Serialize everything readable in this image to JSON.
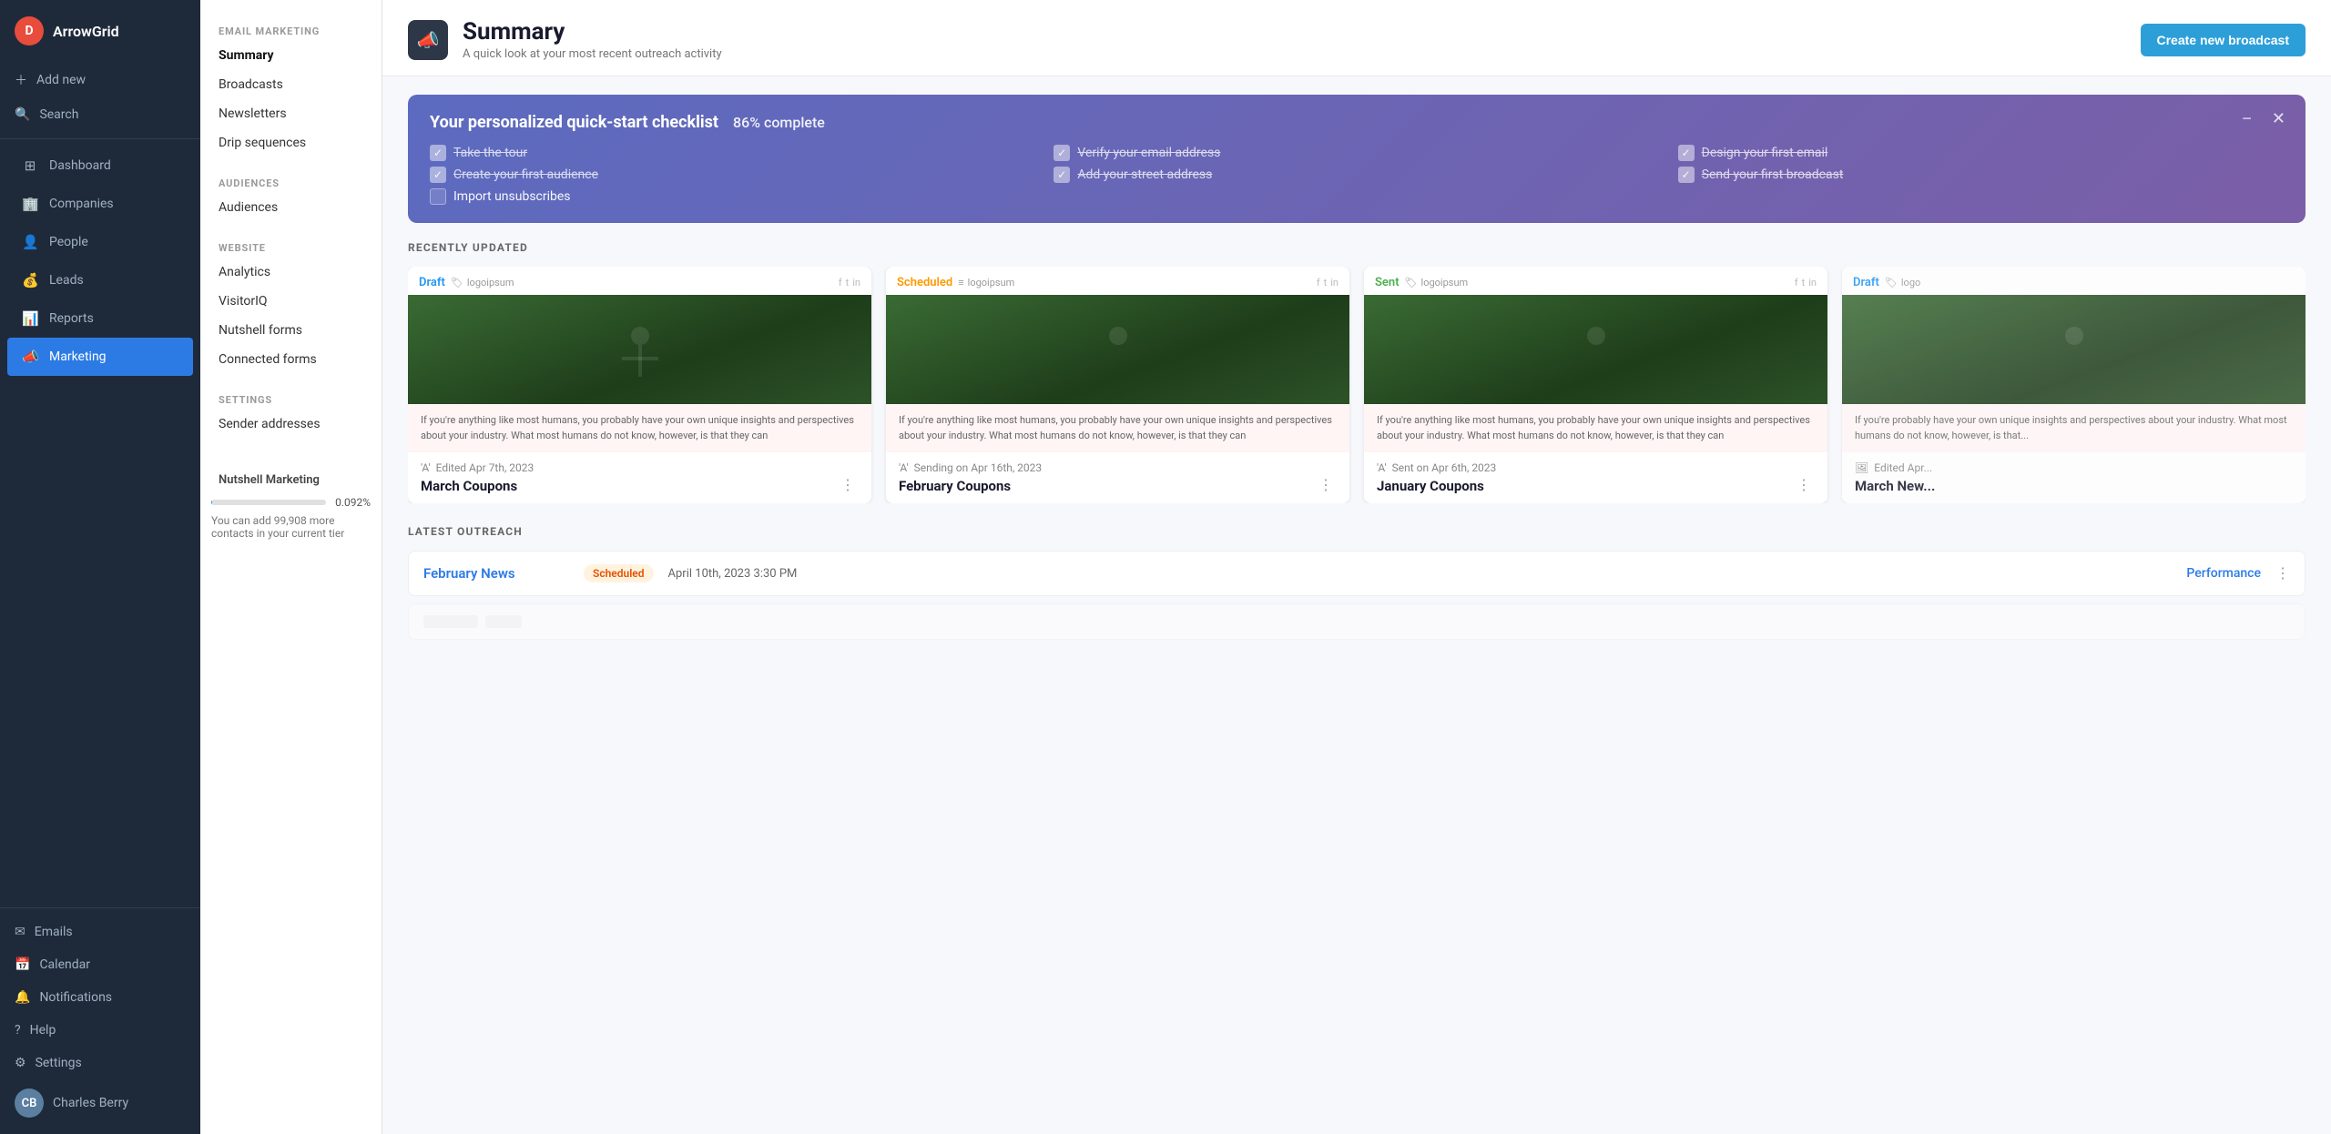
{
  "brand": {
    "logo_letter": "D",
    "name": "ArrowGrid"
  },
  "sidebar": {
    "add_new": "Add new",
    "search": "Search",
    "nav_items": [
      {
        "id": "dashboard",
        "label": "Dashboard",
        "icon": "⊞"
      },
      {
        "id": "companies",
        "label": "Companies",
        "icon": "🏢"
      },
      {
        "id": "people",
        "label": "People",
        "icon": "👤"
      },
      {
        "id": "leads",
        "label": "Leads",
        "icon": "💰"
      },
      {
        "id": "reports",
        "label": "Reports",
        "icon": "📊"
      },
      {
        "id": "marketing",
        "label": "Marketing",
        "icon": "📣",
        "active": true
      }
    ],
    "bottom_items": [
      {
        "id": "emails",
        "label": "Emails",
        "icon": "✉"
      },
      {
        "id": "calendar",
        "label": "Calendar",
        "icon": "📅"
      },
      {
        "id": "notifications",
        "label": "Notifications",
        "icon": "🔔"
      },
      {
        "id": "help",
        "label": "Help",
        "icon": "?"
      },
      {
        "id": "settings",
        "label": "Settings",
        "icon": "⚙"
      }
    ],
    "user_name": "Charles Berry",
    "user_initials": "CB"
  },
  "second_sidebar": {
    "section_email": "EMAIL MARKETING",
    "email_items": [
      {
        "id": "summary",
        "label": "Summary",
        "active": true
      },
      {
        "id": "broadcasts",
        "label": "Broadcasts"
      },
      {
        "id": "newsletters",
        "label": "Newsletters"
      },
      {
        "id": "drip",
        "label": "Drip sequences"
      }
    ],
    "section_audiences": "AUDIENCES",
    "audience_items": [
      {
        "id": "audiences",
        "label": "Audiences"
      }
    ],
    "section_website": "WEBSITE",
    "website_items": [
      {
        "id": "analytics",
        "label": "Analytics"
      },
      {
        "id": "visitoriq",
        "label": "VisitorIQ"
      },
      {
        "id": "nutshell_forms",
        "label": "Nutshell forms"
      },
      {
        "id": "connected_forms",
        "label": "Connected forms"
      }
    ],
    "section_settings": "SETTINGS",
    "settings_items": [
      {
        "id": "sender_addresses",
        "label": "Sender addresses"
      }
    ],
    "marketing_label": "Nutshell Marketing",
    "marketing_progress": 0.092,
    "marketing_progress_text": "0.092%",
    "marketing_info": "You can add 99,908 more contacts in your current tier"
  },
  "page_header": {
    "icon": "📣",
    "title": "Summary",
    "subtitle": "A quick look at your most recent outreach activity",
    "create_button": "Create new broadcast"
  },
  "checklist": {
    "title": "Your personalized quick-start checklist",
    "percent": "86% complete",
    "items": [
      {
        "id": "tour",
        "label": "Take the tour",
        "done": true
      },
      {
        "id": "verify_email",
        "label": "Verify your email address",
        "done": true
      },
      {
        "id": "design_email",
        "label": "Design your first email",
        "done": true
      },
      {
        "id": "first_audience",
        "label": "Create your first audience",
        "done": true
      },
      {
        "id": "street_address",
        "label": "Add your street address",
        "done": true
      },
      {
        "id": "send_broadcast",
        "label": "Send your first broadcast",
        "done": true
      },
      {
        "id": "import_unsubs",
        "label": "Import unsubscribes",
        "done": false
      }
    ]
  },
  "recently_updated": {
    "section_title": "RECENTLY UPDATED",
    "cards": [
      {
        "id": "march-coupons",
        "status": "Draft",
        "status_type": "draft",
        "logo": "logoipsum",
        "edited_icon": "A",
        "edited_text": "Edited Apr 7th, 2023",
        "title": "March Coupons",
        "body_text": "If you're anything like most humans, you probably have your own unique insights and perspectives about your industry. What most humans do not know, however, is that they can"
      },
      {
        "id": "february-coupons",
        "status": "Scheduled",
        "status_type": "scheduled",
        "logo": "logoipsum",
        "edited_icon": "A",
        "edited_text": "Sending on  Apr 16th, 2023",
        "title": "February Coupons",
        "body_text": "If you're anything like most humans, you probably have your own unique insights and perspectives about your industry. What most humans do not know, however, is that they can"
      },
      {
        "id": "january-coupons",
        "status": "Sent",
        "status_type": "sent",
        "logo": "logoipsum",
        "edited_icon": "A",
        "edited_text": "Sent on Apr 6th, 2023",
        "title": "January Coupons",
        "body_text": "If you're anything like most humans, you probably have your own unique insights and perspectives about your industry. What most humans do not know, however, is that they can"
      },
      {
        "id": "march-newsletter",
        "status": "Draft",
        "status_type": "draft",
        "logo": "logo",
        "edited_icon": "A",
        "edited_text": "Edited Apr...",
        "title": "March New...",
        "body_text": "If you're probably have your own unique insights and perspectives about your industry. What most humans do not know, however, is that..."
      }
    ]
  },
  "latest_outreach": {
    "section_title": "LATEST OUTREACH",
    "items": [
      {
        "id": "february-news",
        "name": "February News",
        "status": "Scheduled",
        "status_type": "scheduled",
        "date": "April 10th, 2023 3:30 PM",
        "performance_label": "Performance"
      }
    ]
  }
}
